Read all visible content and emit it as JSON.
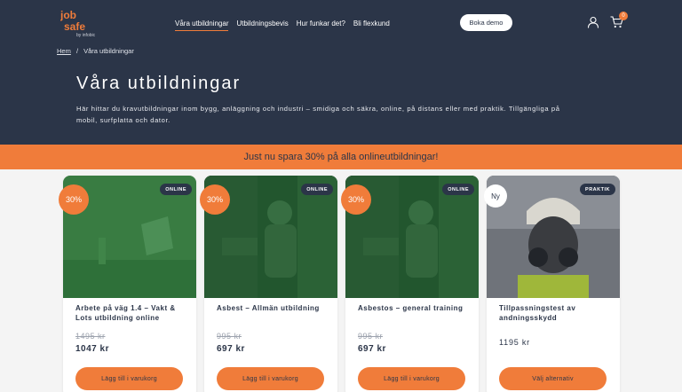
{
  "brand": {
    "logo_text": "job safe",
    "logo_sub": "by infobic"
  },
  "nav": {
    "items": [
      {
        "label": "Våra utbildningar"
      },
      {
        "label": "Utbildningsbevis"
      },
      {
        "label": "Hur funkar det?"
      },
      {
        "label": "Bli flexkund"
      }
    ],
    "active_index": 0,
    "demo_button": "Boka demo",
    "cart_count": "0",
    "icons": [
      "user-icon",
      "cart-icon"
    ]
  },
  "breadcrumb": {
    "home": "Hem",
    "separator": "/",
    "current": "Våra utbildningar"
  },
  "hero": {
    "title": "Våra utbildningar",
    "intro": "Här hittar du kravutbildningar inom bygg, anläggning och industri – smidiga och säkra, online, på distans eller med praktik. Tillgängliga på mobil, surfplatta och dator."
  },
  "promo": {
    "text": "Just nu spara 30% på alla onlineutbildningar!"
  },
  "products": [
    {
      "badge": "30%",
      "tag": "ONLINE",
      "title": "Arbete på väg 1.4 – Vakt & Lots utbildning online",
      "old_price": "1495 kr",
      "price": "1047 kr",
      "button": "Lägg till i varukorg"
    },
    {
      "badge": "30%",
      "tag": "ONLINE",
      "title": "Asbest – Allmän utbildning",
      "old_price": "995 kr",
      "price": "697 kr",
      "button": "Lägg till i varukorg"
    },
    {
      "badge": "30%",
      "tag": "ONLINE",
      "title": "Asbestos – general training",
      "old_price": "995 kr",
      "price": "697 kr",
      "button": "Lägg till i varukorg"
    },
    {
      "badge": "Ny",
      "tag": "PRAKTIK",
      "title": "Tillpassningstest av andningsskydd",
      "price": "1195 kr",
      "button": "Välj alternativ"
    }
  ],
  "colors": {
    "navy": "#2b3548",
    "orange": "#f07c3a",
    "green_overlay": "#2e7a3a"
  }
}
